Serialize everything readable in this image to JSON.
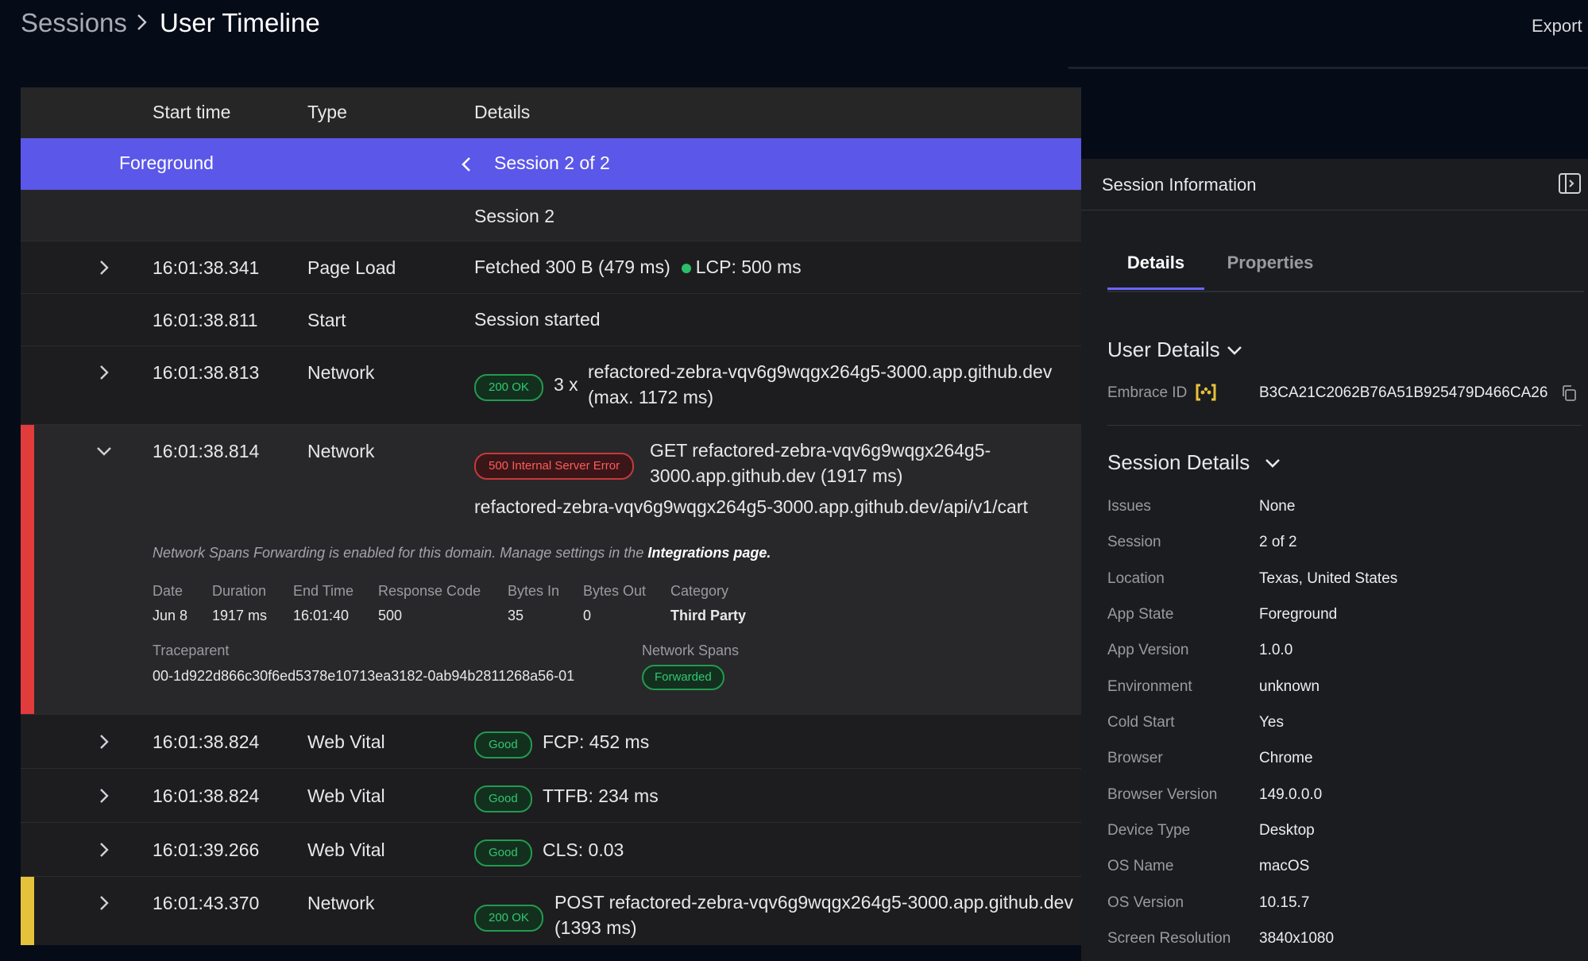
{
  "breadcrumb": {
    "root": "Sessions",
    "current": "User Timeline"
  },
  "header": {
    "export_label": "Export"
  },
  "table": {
    "columns": [
      "Start time",
      "Type",
      "Details"
    ],
    "foreground_label": "Foreground",
    "session_nav": "Session 2 of 2",
    "session_label": "Session 2",
    "rows": [
      {
        "time": "16:01:38.341",
        "type": "Page Load",
        "detail": "Fetched 300 B (479 ms)",
        "extra": "LCP: 500 ms"
      },
      {
        "time": "16:01:38.811",
        "type": "Start",
        "detail": "Session started"
      },
      {
        "time": "16:01:38.813",
        "type": "Network",
        "badge": "200 OK",
        "count": "3 x",
        "detail_l1": "refactored-zebra-vqv6g9wqgx264g5-3000.app.github.dev",
        "detail_l2": "(max. 1172 ms)"
      },
      {
        "time": "16:01:38.814",
        "type": "Network",
        "badge": "500 Internal Server Error",
        "detail_l1": "GET refactored-zebra-vqv6g9wqgx264g5-",
        "detail_l2": "3000.app.github.dev (1917 ms)",
        "url": "refactored-zebra-vqv6g9wqgx264g5-3000.app.github.dev/api/v1/cart"
      },
      {
        "time": "16:01:38.824",
        "type": "Web Vital",
        "badge": "Good",
        "detail": "FCP: 452 ms"
      },
      {
        "time": "16:01:38.824",
        "type": "Web Vital",
        "badge": "Good",
        "detail": "TTFB: 234 ms"
      },
      {
        "time": "16:01:39.266",
        "type": "Web Vital",
        "badge": "Good",
        "detail": "CLS: 0.03"
      },
      {
        "time": "16:01:43.370",
        "type": "Network",
        "badge": "200 OK",
        "detail_l1": "POST refactored-zebra-vqv6g9wqgx264g5-3000.app.github.dev",
        "detail_l2": "(1393 ms)"
      }
    ],
    "expanded": {
      "notice_prefix": "Network Spans Forwarding is enabled for this domain. Manage settings in the ",
      "notice_link": "Integrations page.",
      "fields": [
        {
          "label": "Date",
          "value": "Jun 8"
        },
        {
          "label": "Duration",
          "value": "1917 ms"
        },
        {
          "label": "End Time",
          "value": "16:01:40"
        },
        {
          "label": "Response Code",
          "value": "500"
        },
        {
          "label": "Bytes In",
          "value": "35"
        },
        {
          "label": "Bytes Out",
          "value": "0"
        },
        {
          "label": "Category",
          "value": "Third Party"
        }
      ],
      "traceparent_label": "Traceparent",
      "traceparent_value": "00-1d922d866c30f6ed5378e10713ea3182-0ab94b2811268a56-01",
      "spans_label": "Network Spans",
      "spans_badge": "Forwarded"
    }
  },
  "panel": {
    "title": "Session Information",
    "tabs": [
      "Details",
      "Properties"
    ],
    "user_details_title": "User Details",
    "embrace_id_label": "Embrace ID",
    "embrace_id_value": "B3CA21C2062B76A51B925479D466CA26",
    "session_details_title": "Session Details",
    "session_details": [
      {
        "label": "Issues",
        "value": "None"
      },
      {
        "label": "Session",
        "value": "2 of 2"
      },
      {
        "label": "Location",
        "value": "Texas, United States"
      },
      {
        "label": "App State",
        "value": "Foreground"
      },
      {
        "label": "App Version",
        "value": "1.0.0"
      },
      {
        "label": "Environment",
        "value": "unknown"
      },
      {
        "label": "Cold Start",
        "value": "Yes"
      },
      {
        "label": "Browser",
        "value": "Chrome"
      },
      {
        "label": "Browser Version",
        "value": "149.0.0.0"
      },
      {
        "label": "Device Type",
        "value": "Desktop"
      },
      {
        "label": "OS Name",
        "value": "macOS"
      },
      {
        "label": "OS Version",
        "value": "10.15.7"
      },
      {
        "label": "Screen Resolution",
        "value": "3840x1080"
      }
    ]
  },
  "colors": {
    "accent": "#5b57e8",
    "error": "#e23b3b",
    "warning": "#e5c23a",
    "success": "#2bbf6a"
  }
}
